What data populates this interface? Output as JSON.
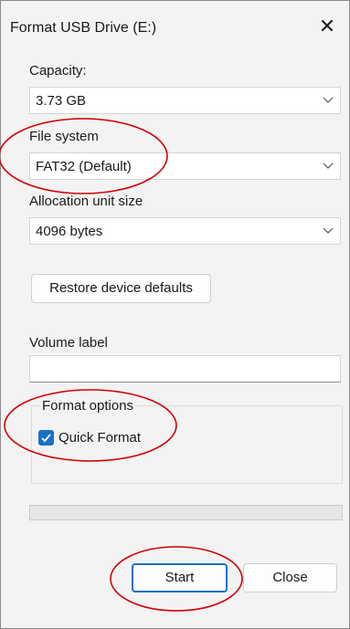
{
  "window": {
    "title": "Format USB Drive (E:)",
    "close_glyph": "✕"
  },
  "capacity": {
    "label": "Capacity:",
    "value": "3.73 GB"
  },
  "file_system": {
    "label": "File system",
    "value": "FAT32 (Default)"
  },
  "allocation": {
    "label": "Allocation unit size",
    "value": "4096 bytes"
  },
  "restore_button": "Restore device defaults",
  "volume_label": {
    "label": "Volume label",
    "value": ""
  },
  "format_options": {
    "legend": "Format options",
    "quick_format_label": "Quick Format",
    "quick_format_checked": true
  },
  "progress": {
    "fraction": 0
  },
  "buttons": {
    "start": "Start",
    "close": "Close"
  },
  "colors": {
    "accent": "#1a6fc7",
    "annotation_red": "#d00000",
    "background": "#f3f3f3"
  },
  "icons": {
    "dropdown": "chevron-down-icon",
    "close": "close-icon",
    "check": "checkmark-icon"
  }
}
